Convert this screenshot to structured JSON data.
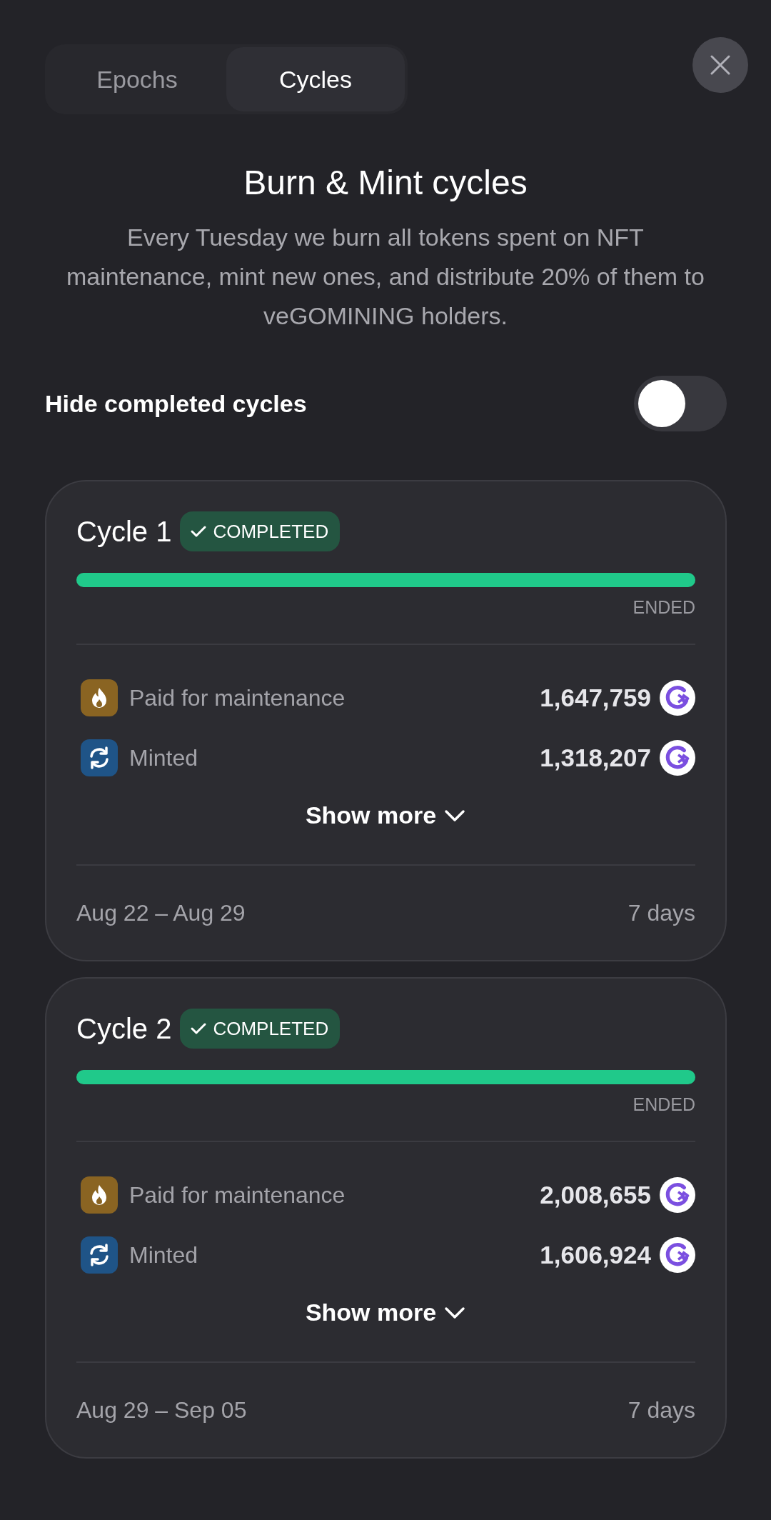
{
  "tabs": [
    {
      "label": "Epochs",
      "selected": false
    },
    {
      "label": "Cycles",
      "selected": true
    }
  ],
  "title": "Burn & Mint cycles",
  "description": "Every Tuesday we burn all tokens spent on NFT maintenance, mint new ones, and distribute 20% of them to veGOMINING holders.",
  "hide_completed": {
    "label": "Hide completed cycles",
    "on": false
  },
  "cycles": [
    {
      "title": "Cycle 1",
      "badge": "COMPLETED",
      "level": 1,
      "status": "ENDED",
      "rows": [
        {
          "kind": "burn",
          "label": "Paid for maintenance",
          "amount": "1,647,759"
        },
        {
          "kind": "mint",
          "label": "Minted",
          "amount": "1,318,207"
        }
      ],
      "show_more": "Show more",
      "dates": "Aug 22 – Aug 29",
      "duration": "7 days"
    },
    {
      "title": "Cycle 2",
      "badge": "COMPLETED",
      "level": 1,
      "status": "ENDED",
      "rows": [
        {
          "kind": "burn",
          "label": "Paid for maintenance",
          "amount": "2,008,655"
        },
        {
          "kind": "mint",
          "label": "Minted",
          "amount": "1,606,924"
        }
      ],
      "show_more": "Show more",
      "dates": "Aug 29 – Sep 05",
      "duration": "7 days"
    }
  ]
}
